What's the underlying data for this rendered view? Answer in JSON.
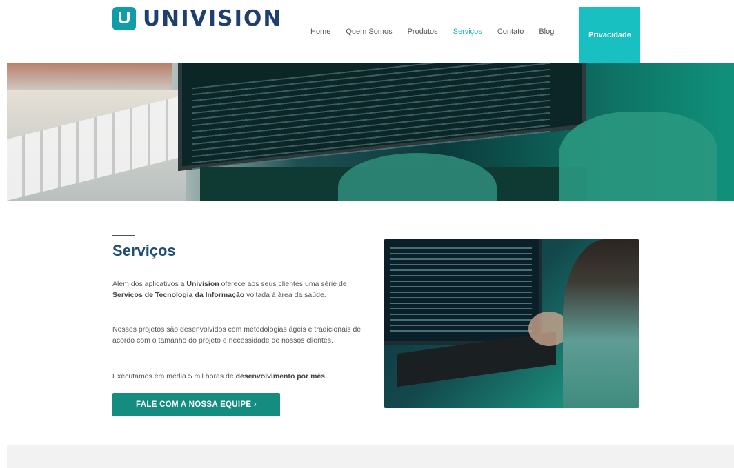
{
  "brand": {
    "name": "UNIVISION"
  },
  "nav": {
    "items": [
      "Home",
      "Quem Somos",
      "Produtos",
      "Serviços",
      "Contato",
      "Blog"
    ],
    "active": "Serviços",
    "cta_label": "Privacidade"
  },
  "section": {
    "title": "Serviços",
    "p1_a": "Além dos aplicativos a ",
    "p1_b": "Univision",
    "p1_c": " oferece aos seus clientes uma série de ",
    "p1_d": "Serviços de Tecnologia da Informação",
    "p1_e": " voltada à área da saúde.",
    "p2_a": "Nossos projetos são desenvolvidos com metodologias ágeis e tradicionais de acordo com o tamanho do projeto e necessidade de nossos clientes.",
    "p3_a": "Executamos em média 5 mil horas de ",
    "p3_b": "desenvolvimento por mês.",
    "button_label": "FALE COM A NOSSA EQUIPE  ›"
  },
  "colors": {
    "brand_teal": "#0f9ea8",
    "nav_active": "#1bb4b8",
    "nav_cta_bg": "#19c0c2",
    "title_blue": "#1f4e79",
    "button_bg": "#148c80"
  },
  "icons": {
    "logo": "u-logo-icon"
  }
}
